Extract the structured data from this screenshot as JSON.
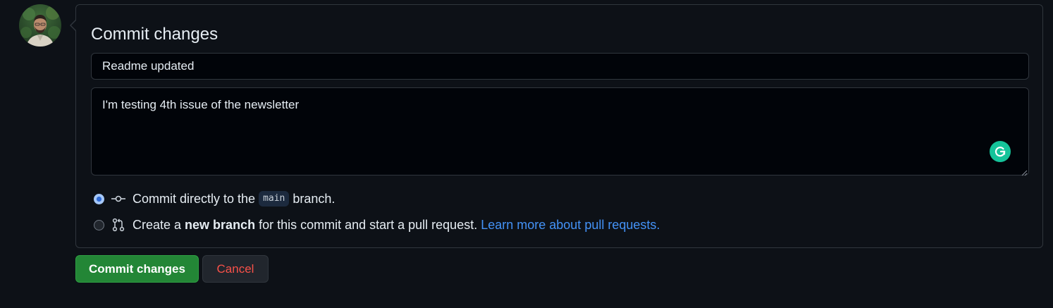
{
  "form": {
    "heading": "Commit changes",
    "summary_value": "Readme updated",
    "description_value": "I'm testing 4th issue of the newsletter"
  },
  "options": {
    "direct": {
      "checked": true,
      "prefix": "Commit directly to the",
      "branch_name": "main",
      "suffix": "branch."
    },
    "new_branch": {
      "checked": false,
      "prefix": "Create a",
      "bold_text": "new branch",
      "suffix": "for this commit and start a pull request.",
      "link_text": "Learn more about pull requests."
    }
  },
  "buttons": {
    "commit_label": "Commit changes",
    "cancel_label": "Cancel"
  },
  "icons": {
    "avatar": "user-avatar",
    "commit": "git-commit-icon",
    "pull_request": "git-pull-request-icon",
    "grammarly": "grammarly-icon"
  },
  "colors": {
    "background": "#0d1117",
    "border": "#30363d",
    "primary_button": "#238636",
    "danger_text": "#f85149",
    "link": "#4493f8",
    "grammarly": "#15c39a"
  }
}
